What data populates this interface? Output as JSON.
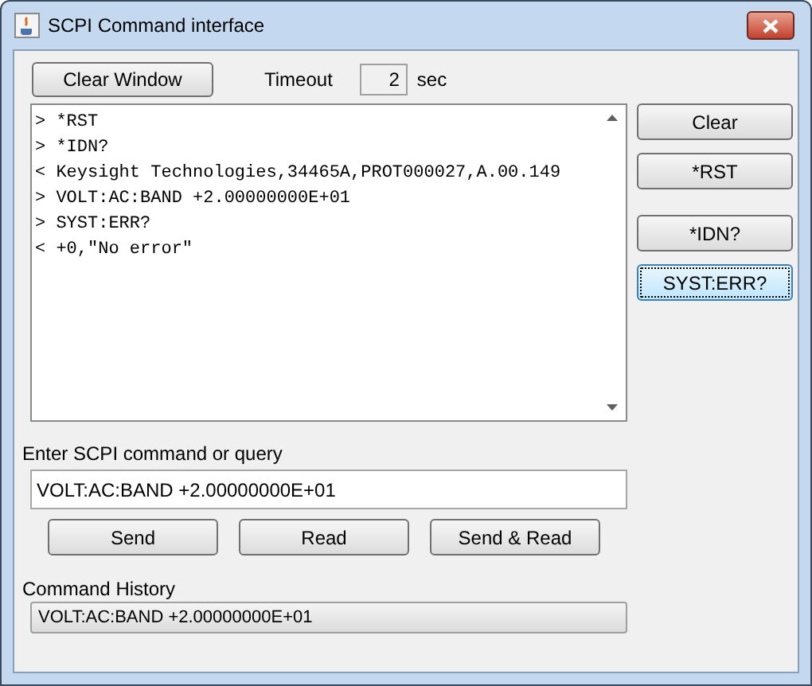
{
  "window": {
    "title": "SCPI Command interface"
  },
  "toolbar": {
    "clear_button": "Clear Window",
    "timeout_label": "Timeout",
    "timeout_value": "2",
    "timeout_unit": "sec"
  },
  "console": {
    "lines": [
      "> *RST",
      "> *IDN?",
      "< Keysight Technologies,34465A,PROT000027,A.00.149",
      "> VOLT:AC:BAND +2.00000000E+01",
      "> SYST:ERR?",
      "< +0,\"No error\""
    ]
  },
  "side_button_groups": [
    [
      {
        "label": "Clear",
        "focused": false
      },
      {
        "label": "*RST",
        "focused": false
      }
    ],
    [
      {
        "label": "*IDN?",
        "focused": false
      },
      {
        "label": "SYST:ERR?",
        "focused": true
      }
    ]
  ],
  "command": {
    "label": "Enter SCPI command or query",
    "value": "VOLT:AC:BAND +2.00000000E+01"
  },
  "action_buttons": [
    "Send",
    "Read",
    "Send & Read"
  ],
  "history": {
    "label": "Command History",
    "value": "VOLT:AC:BAND +2.00000000E+01"
  }
}
